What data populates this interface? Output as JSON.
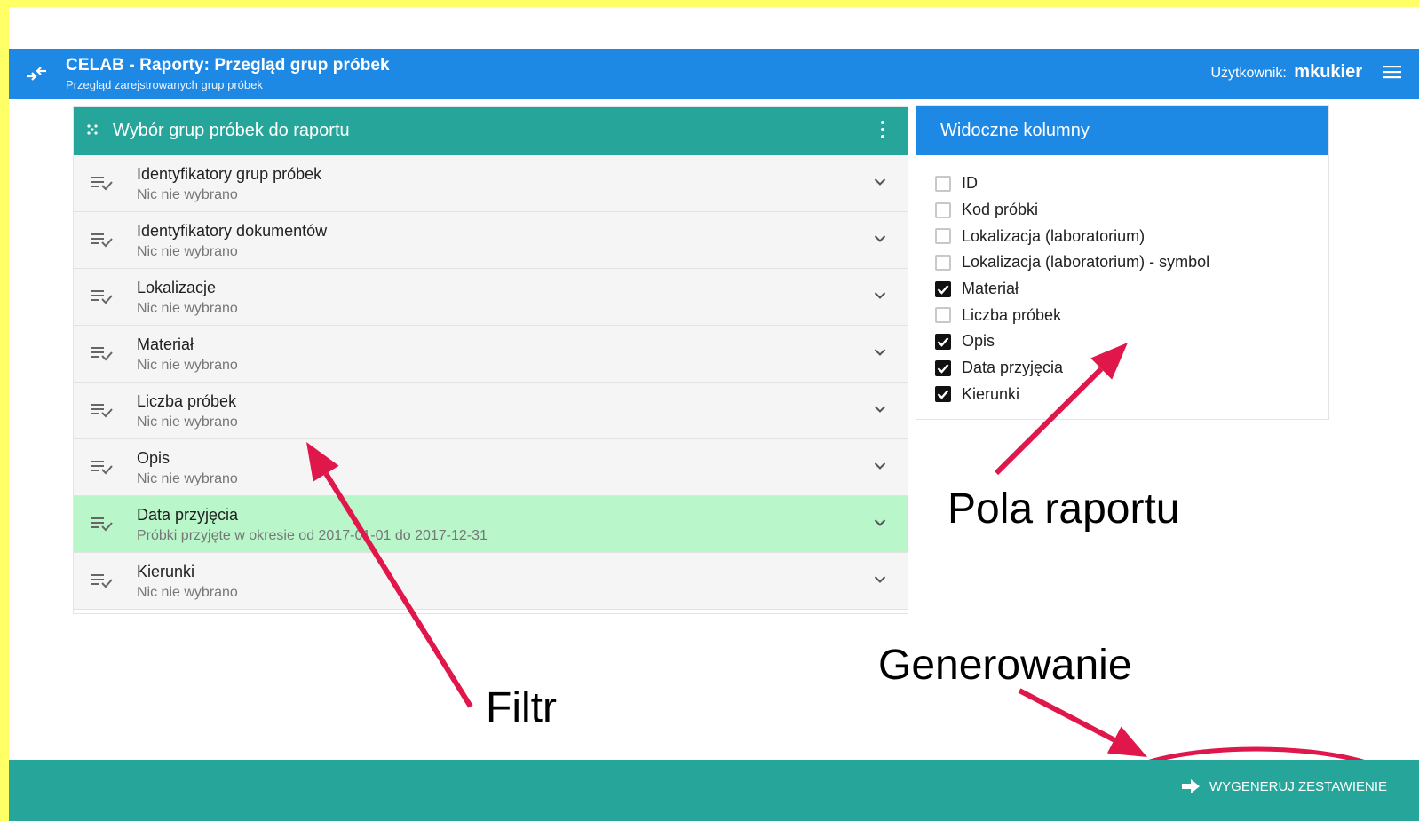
{
  "header": {
    "title": "CELAB - Raporty: Przegląd grup próbek",
    "subtitle": "Przegląd zarejstrowanych grup próbek",
    "user_label": "Użytkownik:",
    "username": "mkukier"
  },
  "filter_panel": {
    "title": "Wybór grup próbek do raportu",
    "rows": [
      {
        "title": "Identyfikatory grup próbek",
        "sub": "Nic nie wybrano",
        "active": false
      },
      {
        "title": "Identyfikatory dokumentów",
        "sub": "Nic nie wybrano",
        "active": false
      },
      {
        "title": "Lokalizacje",
        "sub": "Nic nie wybrano",
        "active": false
      },
      {
        "title": "Materiał",
        "sub": "Nic nie wybrano",
        "active": false
      },
      {
        "title": "Liczba próbek",
        "sub": "Nic nie wybrano",
        "active": false
      },
      {
        "title": "Opis",
        "sub": "Nic nie wybrano",
        "active": false
      },
      {
        "title": "Data przyjęcia",
        "sub": "Próbki przyjęte w okresie od 2017-01-01 do 2017-12-31",
        "active": true
      },
      {
        "title": "Kierunki",
        "sub": "Nic nie wybrano",
        "active": false
      }
    ]
  },
  "columns_panel": {
    "title": "Widoczne kolumny",
    "items": [
      {
        "label": "ID",
        "checked": false
      },
      {
        "label": "Kod próbki",
        "checked": false
      },
      {
        "label": "Lokalizacja (laboratorium)",
        "checked": false
      },
      {
        "label": "Lokalizacja (laboratorium) - symbol",
        "checked": false
      },
      {
        "label": "Materiał",
        "checked": true
      },
      {
        "label": "Liczba próbek",
        "checked": false
      },
      {
        "label": "Opis",
        "checked": true
      },
      {
        "label": "Data przyjęcia",
        "checked": true
      },
      {
        "label": "Kierunki",
        "checked": true
      }
    ]
  },
  "annotations": {
    "fields": "Pola raportu",
    "generate": "Generowanie",
    "filter": "Filtr",
    "arrow_color": "#e0174a"
  },
  "footer": {
    "generate_label": "WYGENERUJ ZESTAWIENIE"
  },
  "colors": {
    "primary": "#1e88e5",
    "teal": "#26a69a",
    "active_row": "#b9f6ca",
    "frame": "#ffff66"
  }
}
